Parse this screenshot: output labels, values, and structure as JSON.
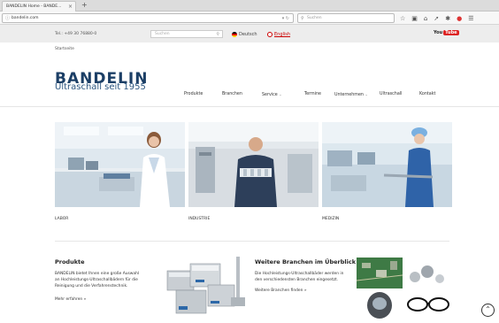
{
  "browser": {
    "tab_title": "BANDELIN Home - BANDE...",
    "tab_close": "×",
    "new_tab": "+",
    "url": "bandelin.com",
    "search_placeholder": "Suchen",
    "toolbar_icons": [
      "star-icon",
      "clipboard-icon",
      "home-icon",
      "send-icon",
      "extension-icon",
      "adblock-icon",
      "menu-icon"
    ]
  },
  "topbar": {
    "phone": "Tel.: +49 30 76880-0",
    "search_placeholder": "Suchen",
    "lang_de": "Deutsch",
    "lang_en": "English",
    "youtube_you": "You",
    "youtube_tube": "Tube"
  },
  "breadcrumb": "Startseite",
  "logo": {
    "title": "BANDELIN",
    "subtitle": "Ultraschall seit 1955"
  },
  "nav": {
    "items": [
      "Produkte",
      "Branchen",
      "Service",
      "Termine",
      "Unternehmen",
      "Ultraschall",
      "Kontakt"
    ]
  },
  "cards": [
    {
      "label": "LABOR"
    },
    {
      "label": "INDUSTRIE"
    },
    {
      "label": "MEDIZIN"
    }
  ],
  "produkte": {
    "title": "Produkte",
    "text1": "BANDELIN bietet Ihnen eine große Auswahl",
    "text2": "an Hochleistungs-Ultraschallbädern für die",
    "text3": "Reinigung und die Verfahrenstechnik.",
    "link": "Mehr erfahren »"
  },
  "branchen": {
    "title": "Weitere Branchen im Überblick",
    "text1": "Die Hochleistungs-Ultraschallbäder werden in",
    "text2": "den verschiedensten Branchen eingesetzt.",
    "link": "Weitere Branchen finden »"
  },
  "colors": {
    "brand_blue": "#1c3f66",
    "accent_red": "#cc0000",
    "topbar_grey": "#ededed"
  }
}
